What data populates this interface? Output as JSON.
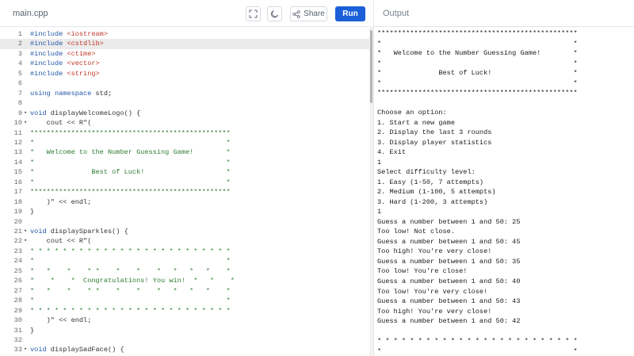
{
  "header": {
    "file_tab": "main.cpp",
    "share_label": "Share",
    "run_label": "Run",
    "output_tab": "Output"
  },
  "editor": {
    "lines": [
      {
        "n": "1",
        "fold": "",
        "segs": [
          {
            "t": "#include ",
            "c": "kw"
          },
          {
            "t": "<iostream>",
            "c": "str"
          }
        ]
      },
      {
        "n": "2",
        "fold": "",
        "active": true,
        "segs": [
          {
            "t": "#include ",
            "c": "kw"
          },
          {
            "t": "<cstdlib>",
            "c": "str"
          }
        ]
      },
      {
        "n": "3",
        "fold": "",
        "segs": [
          {
            "t": "#include ",
            "c": "kw"
          },
          {
            "t": "<ctime>",
            "c": "str"
          }
        ]
      },
      {
        "n": "4",
        "fold": "",
        "segs": [
          {
            "t": "#include ",
            "c": "kw"
          },
          {
            "t": "<vector>",
            "c": "str"
          }
        ]
      },
      {
        "n": "5",
        "fold": "",
        "segs": [
          {
            "t": "#include ",
            "c": "kw"
          },
          {
            "t": "<string>",
            "c": "str"
          }
        ]
      },
      {
        "n": "6",
        "fold": "",
        "segs": []
      },
      {
        "n": "7",
        "fold": "",
        "segs": [
          {
            "t": "using namespace ",
            "c": "kw"
          },
          {
            "t": "std;",
            "c": "pl"
          }
        ]
      },
      {
        "n": "8",
        "fold": "",
        "segs": []
      },
      {
        "n": "9",
        "fold": "▾",
        "segs": [
          {
            "t": "void ",
            "c": "kw"
          },
          {
            "t": "displayWelcomeLogo() {",
            "c": "pl"
          }
        ]
      },
      {
        "n": "10",
        "fold": "▾",
        "segs": [
          {
            "t": "    cout << R\"(",
            "c": "pl"
          }
        ]
      },
      {
        "n": "11",
        "fold": "",
        "segs": [
          {
            "t": "*************************************************",
            "c": "raw"
          }
        ]
      },
      {
        "n": "12",
        "fold": "",
        "segs": [
          {
            "t": "*                                               *",
            "c": "raw"
          }
        ]
      },
      {
        "n": "13",
        "fold": "",
        "segs": [
          {
            "t": "*   Welcome to the Number Guessing Game!        *",
            "c": "raw"
          }
        ]
      },
      {
        "n": "14",
        "fold": "",
        "segs": [
          {
            "t": "*                                               *",
            "c": "raw"
          }
        ]
      },
      {
        "n": "15",
        "fold": "",
        "segs": [
          {
            "t": "*              Best of Luck!                    *",
            "c": "raw"
          }
        ]
      },
      {
        "n": "16",
        "fold": "",
        "segs": [
          {
            "t": "*                                               *",
            "c": "raw"
          }
        ]
      },
      {
        "n": "17",
        "fold": "",
        "segs": [
          {
            "t": "*************************************************",
            "c": "raw"
          }
        ]
      },
      {
        "n": "18",
        "fold": "",
        "segs": [
          {
            "t": "    )\" << endl;",
            "c": "pl"
          }
        ]
      },
      {
        "n": "19",
        "fold": "",
        "segs": [
          {
            "t": "}",
            "c": "pl"
          }
        ]
      },
      {
        "n": "20",
        "fold": "",
        "segs": []
      },
      {
        "n": "21",
        "fold": "▾",
        "segs": [
          {
            "t": "void ",
            "c": "kw"
          },
          {
            "t": "displaySparkles() {",
            "c": "pl"
          }
        ]
      },
      {
        "n": "22",
        "fold": "▾",
        "segs": [
          {
            "t": "    cout << R\"(",
            "c": "pl"
          }
        ]
      },
      {
        "n": "23",
        "fold": "",
        "segs": [
          {
            "t": "* * * * * * * * * * * * * * * * * * * * * * * * *",
            "c": "raw"
          }
        ]
      },
      {
        "n": "24",
        "fold": "",
        "segs": [
          {
            "t": "*                                               *",
            "c": "raw"
          }
        ]
      },
      {
        "n": "25",
        "fold": "",
        "segs": [
          {
            "t": "*   *    *    * *    *    *    *   *   *   *    *",
            "c": "raw"
          }
        ]
      },
      {
        "n": "26",
        "fold": "",
        "segs": [
          {
            "t": "*    *    *  Congratulations! You win!  *   *    *",
            "c": "raw"
          }
        ]
      },
      {
        "n": "27",
        "fold": "",
        "segs": [
          {
            "t": "*   *    *    * *    *    *    *   *   *   *    *",
            "c": "raw"
          }
        ]
      },
      {
        "n": "28",
        "fold": "",
        "segs": [
          {
            "t": "*                                               *",
            "c": "raw"
          }
        ]
      },
      {
        "n": "29",
        "fold": "",
        "segs": [
          {
            "t": "* * * * * * * * * * * * * * * * * * * * * * * * *",
            "c": "raw"
          }
        ]
      },
      {
        "n": "30",
        "fold": "",
        "segs": [
          {
            "t": "    )\" << endl;",
            "c": "pl"
          }
        ]
      },
      {
        "n": "31",
        "fold": "",
        "segs": [
          {
            "t": "}",
            "c": "pl"
          }
        ]
      },
      {
        "n": "32",
        "fold": "",
        "segs": []
      },
      {
        "n": "33",
        "fold": "▾",
        "segs": [
          {
            "t": "void ",
            "c": "kw"
          },
          {
            "t": "displaySadFace() {",
            "c": "pl"
          }
        ]
      }
    ]
  },
  "output": {
    "lines": [
      "*************************************************",
      "*                                               *",
      "*   Welcome to the Number Guessing Game!        *",
      "*                                               *",
      "*              Best of Luck!                    *",
      "*                                               *",
      "*************************************************",
      "",
      "Choose an option:",
      "1. Start a new game",
      "2. Display the last 3 rounds",
      "3. Display player statistics",
      "4. Exit",
      "1",
      "Select difficulty level:",
      "1. Easy (1-50, 7 attempts)",
      "2. Medium (1-100, 5 attempts)",
      "3. Hard (1-200, 3 attempts)",
      "1",
      "Guess a number between 1 and 50: 25",
      "Too low! Not close.",
      "Guess a number between 1 and 50: 45",
      "Too high! You're very close!",
      "Guess a number between 1 and 50: 35",
      "Too low! You're close!",
      "Guess a number between 1 and 50: 40",
      "Too low! You're very close!",
      "Guess a number between 1 and 50: 43",
      "Too high! You're very close!",
      "Guess a number between 1 and 50: 42",
      "",
      "* * * * * * * * * * * * * * * * * * * * * * * * *",
      "*                                               *",
      "*   *    *    * *    *    *    *   *   *   *    *"
    ]
  },
  "icons": {
    "fullscreen": "fullscreen-icon",
    "theme": "moon-icon",
    "share": "share-icon"
  }
}
